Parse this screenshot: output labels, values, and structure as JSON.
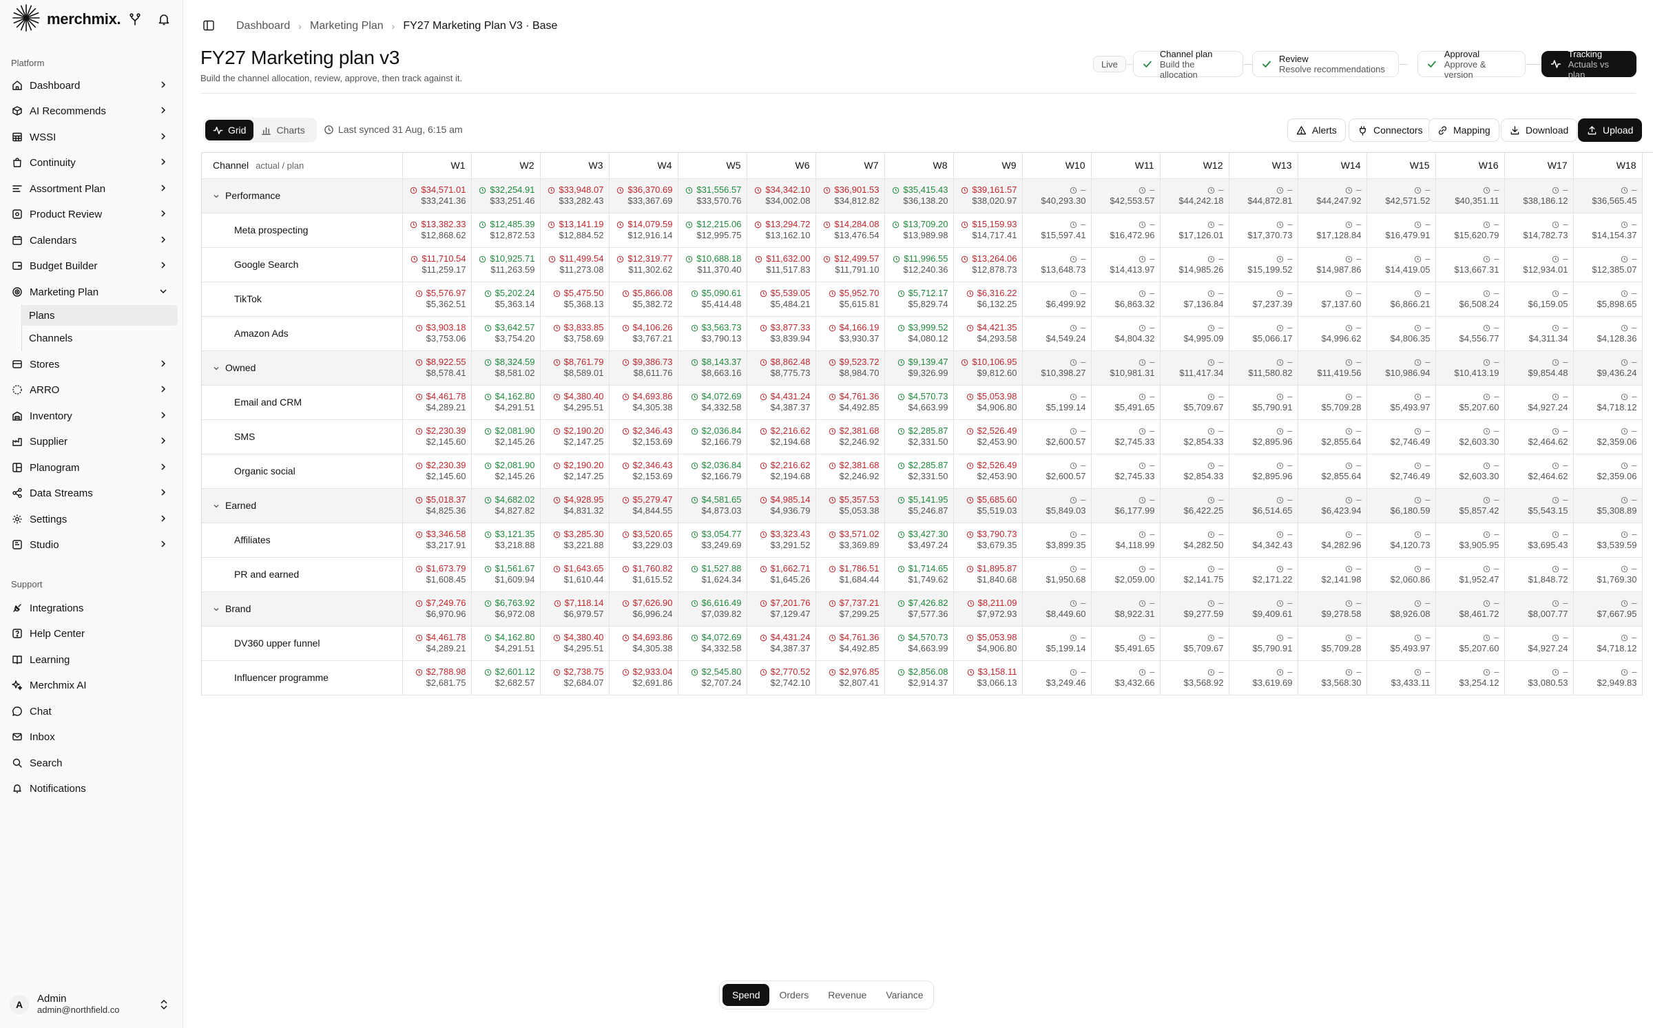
{
  "brand": {
    "name": "merchmix.",
    "icons": [
      "merge-icon",
      "bell-icon"
    ]
  },
  "sidebar": {
    "platform_label": "Platform",
    "support_label": "Support",
    "platform": [
      {
        "label": "Dashboard",
        "icon": "home-icon"
      },
      {
        "label": "AI Recommends",
        "icon": "box-icon"
      },
      {
        "label": "WSSI",
        "icon": "table-icon"
      },
      {
        "label": "Continuity",
        "icon": "bag-icon"
      },
      {
        "label": "Assortment Plan",
        "icon": "list-icon"
      },
      {
        "label": "Product Review",
        "icon": "review-icon"
      },
      {
        "label": "Calendars",
        "icon": "calendar-icon"
      },
      {
        "label": "Budget Builder",
        "icon": "budget-icon"
      },
      {
        "label": "Marketing Plan",
        "icon": "target-icon"
      },
      {
        "label": "Stores",
        "icon": "store-icon"
      },
      {
        "label": "ARRO",
        "icon": "arro-icon"
      },
      {
        "label": "Inventory",
        "icon": "warehouse-icon"
      },
      {
        "label": "Supplier",
        "icon": "supplier-icon"
      },
      {
        "label": "Planogram",
        "icon": "planogram-icon"
      },
      {
        "label": "Data Streams",
        "icon": "share-icon"
      },
      {
        "label": "Settings",
        "icon": "gear-icon"
      },
      {
        "label": "Studio",
        "icon": "studio-icon"
      }
    ],
    "marketing_sub": [
      "Plans",
      "Channels"
    ],
    "support": [
      {
        "label": "Integrations",
        "icon": "plug-icon"
      },
      {
        "label": "Help Center",
        "icon": "help-icon"
      },
      {
        "label": "Learning",
        "icon": "book-icon"
      },
      {
        "label": "Merchmix AI",
        "icon": "sparkle-icon"
      },
      {
        "label": "Chat",
        "icon": "chat-icon"
      },
      {
        "label": "Inbox",
        "icon": "mail-icon"
      },
      {
        "label": "Search",
        "icon": "search-icon"
      },
      {
        "label": "Notifications",
        "icon": "bell-icon"
      }
    ],
    "user": {
      "initial": "A",
      "name": "Admin",
      "email": "admin@northfield.co"
    }
  },
  "breadcrumb": [
    "Dashboard",
    "Marketing Plan",
    "FY27 Marketing Plan V3 · Base"
  ],
  "page": {
    "title": "FY27 Marketing plan v3",
    "subtitle": "Build the channel allocation, review, approve, then track against it."
  },
  "stages": {
    "live": "Live",
    "items": [
      {
        "title": "Channel plan",
        "desc": "Build the allocation"
      },
      {
        "title": "Review",
        "desc": "Resolve recommendations"
      },
      {
        "title": "Approval",
        "desc": "Approve & version"
      },
      {
        "title": "Tracking",
        "desc": "Actuals vs plan"
      }
    ]
  },
  "toolbar": {
    "grid": "Grid",
    "charts": "Charts",
    "synced": "Last synced 31 Aug, 6:15 am",
    "alerts": "Alerts",
    "connectors": "Connectors",
    "mapping": "Mapping",
    "download": "Download",
    "upload": "Upload"
  },
  "grid": {
    "channel_header": "Channel",
    "channel_sub": "actual / plan",
    "weeks": [
      "W1",
      "W2",
      "W3",
      "W4",
      "W5",
      "W6",
      "W7",
      "W8",
      "W9",
      "W10",
      "W11",
      "W12",
      "W13",
      "W14",
      "W15",
      "W16",
      "W17",
      "W18"
    ],
    "pending_mark": "–",
    "rows": [
      {
        "type": "group",
        "name": "Performance",
        "actual": [
          "$34,571.01",
          "$32,254.91",
          "$33,948.07",
          "$36,370.69",
          "$31,556.57",
          "$34,342.10",
          "$36,901.53",
          "$35,415.43",
          "$39,161.57"
        ],
        "status": [
          "o",
          "u",
          "o",
          "o",
          "u",
          "o",
          "o",
          "u",
          "o"
        ],
        "plan": [
          "$33,241.36",
          "$33,251.46",
          "$33,282.43",
          "$33,367.69",
          "$33,570.76",
          "$34,002.08",
          "$34,812.82",
          "$36,138.20",
          "$38,020.97",
          "$40,293.30",
          "$42,553.57",
          "$44,242.18",
          "$44,872.81",
          "$44,247.92",
          "$42,571.52",
          "$40,351.11",
          "$38,186.12",
          "$36,565.45"
        ]
      },
      {
        "type": "row",
        "name": "Meta prospecting",
        "actual": [
          "$13,382.33",
          "$12,485.39",
          "$13,141.19",
          "$14,079.59",
          "$12,215.06",
          "$13,294.72",
          "$14,284.08",
          "$13,709.20",
          "$15,159.93"
        ],
        "status": [
          "o",
          "u",
          "o",
          "o",
          "u",
          "o",
          "o",
          "u",
          "o"
        ],
        "plan": [
          "$12,868.62",
          "$12,872.53",
          "$12,884.52",
          "$12,916.14",
          "$12,995.75",
          "$13,162.10",
          "$13,476.54",
          "$13,989.98",
          "$14,717.41",
          "$15,597.41",
          "$16,472.96",
          "$17,126.01",
          "$17,370.73",
          "$17,128.84",
          "$16,479.91",
          "$15,620.79",
          "$14,782.73",
          "$14,154.37"
        ]
      },
      {
        "type": "row",
        "name": "Google Search",
        "actual": [
          "$11,710.54",
          "$10,925.71",
          "$11,499.54",
          "$12,319.77",
          "$10,688.18",
          "$11,632.00",
          "$12,499.57",
          "$11,996.55",
          "$13,264.06"
        ],
        "status": [
          "o",
          "u",
          "o",
          "o",
          "u",
          "o",
          "o",
          "u",
          "o"
        ],
        "plan": [
          "$11,259.17",
          "$11,263.59",
          "$11,273.08",
          "$11,302.62",
          "$11,370.40",
          "$11,517.83",
          "$11,791.10",
          "$12,240.36",
          "$12,878.73",
          "$13,648.73",
          "$14,413.97",
          "$14,985.26",
          "$15,199.52",
          "$14,987.86",
          "$14,419.05",
          "$13,667.31",
          "$12,934.01",
          "$12,385.07"
        ]
      },
      {
        "type": "row",
        "name": "TikTok",
        "actual": [
          "$5,576.97",
          "$5,202.24",
          "$5,475.50",
          "$5,866.08",
          "$5,090.61",
          "$5,539.05",
          "$5,952.70",
          "$5,712.17",
          "$6,316.22"
        ],
        "status": [
          "o",
          "u",
          "o",
          "o",
          "u",
          "o",
          "o",
          "u",
          "o"
        ],
        "plan": [
          "$5,362.51",
          "$5,363.14",
          "$5,368.13",
          "$5,382.72",
          "$5,414.48",
          "$5,484.21",
          "$5,615.81",
          "$5,829.74",
          "$6,132.25",
          "$6,499.92",
          "$6,863.32",
          "$7,136.84",
          "$7,237.39",
          "$7,137.60",
          "$6,866.21",
          "$6,508.24",
          "$6,159.05",
          "$5,898.65"
        ]
      },
      {
        "type": "row",
        "name": "Amazon Ads",
        "actual": [
          "$3,903.18",
          "$3,642.57",
          "$3,833.85",
          "$4,106.26",
          "$3,563.73",
          "$3,877.33",
          "$4,166.19",
          "$3,999.52",
          "$4,421.35"
        ],
        "status": [
          "o",
          "u",
          "o",
          "o",
          "u",
          "o",
          "o",
          "u",
          "o"
        ],
        "plan": [
          "$3,753.06",
          "$3,754.20",
          "$3,758.69",
          "$3,767.21",
          "$3,790.13",
          "$3,839.94",
          "$3,930.37",
          "$4,080.12",
          "$4,293.58",
          "$4,549.24",
          "$4,804.32",
          "$4,995.09",
          "$5,066.17",
          "$4,996.62",
          "$4,806.35",
          "$4,556.77",
          "$4,311.34",
          "$4,128.36"
        ]
      },
      {
        "type": "group",
        "name": "Owned",
        "actual": [
          "$8,922.55",
          "$8,324.59",
          "$8,761.79",
          "$9,386.73",
          "$8,143.37",
          "$8,862.48",
          "$9,523.72",
          "$9,139.47",
          "$10,106.95"
        ],
        "status": [
          "o",
          "u",
          "o",
          "o",
          "u",
          "o",
          "o",
          "u",
          "o"
        ],
        "plan": [
          "$8,578.41",
          "$8,581.02",
          "$8,589.01",
          "$8,611.76",
          "$8,663.16",
          "$8,775.73",
          "$8,984.70",
          "$9,326.99",
          "$9,812.60",
          "$10,398.27",
          "$10,981.31",
          "$11,417.34",
          "$11,580.82",
          "$11,419.56",
          "$10,986.94",
          "$10,413.19",
          "$9,854.48",
          "$9,436.24"
        ]
      },
      {
        "type": "row",
        "name": "Email and CRM",
        "actual": [
          "$4,461.78",
          "$4,162.80",
          "$4,380.40",
          "$4,693.86",
          "$4,072.69",
          "$4,431.24",
          "$4,761.36",
          "$4,570.73",
          "$5,053.98"
        ],
        "status": [
          "o",
          "u",
          "o",
          "o",
          "u",
          "o",
          "o",
          "u",
          "o"
        ],
        "plan": [
          "$4,289.21",
          "$4,291.51",
          "$4,295.51",
          "$4,305.38",
          "$4,332.58",
          "$4,387.37",
          "$4,492.85",
          "$4,663.99",
          "$4,906.80",
          "$5,199.14",
          "$5,491.65",
          "$5,709.67",
          "$5,790.91",
          "$5,709.28",
          "$5,493.97",
          "$5,207.60",
          "$4,927.24",
          "$4,718.12"
        ]
      },
      {
        "type": "row",
        "name": "SMS",
        "actual": [
          "$2,230.39",
          "$2,081.90",
          "$2,190.20",
          "$2,346.43",
          "$2,036.84",
          "$2,216.62",
          "$2,381.68",
          "$2,285.87",
          "$2,526.49"
        ],
        "status": [
          "o",
          "u",
          "o",
          "o",
          "u",
          "o",
          "o",
          "u",
          "o"
        ],
        "plan": [
          "$2,145.60",
          "$2,145.26",
          "$2,147.25",
          "$2,153.69",
          "$2,166.79",
          "$2,194.68",
          "$2,246.92",
          "$2,331.50",
          "$2,453.90",
          "$2,600.57",
          "$2,745.33",
          "$2,854.33",
          "$2,895.96",
          "$2,855.64",
          "$2,746.49",
          "$2,603.30",
          "$2,464.62",
          "$2,359.06"
        ]
      },
      {
        "type": "row",
        "name": "Organic social",
        "actual": [
          "$2,230.39",
          "$2,081.90",
          "$2,190.20",
          "$2,346.43",
          "$2,036.84",
          "$2,216.62",
          "$2,381.68",
          "$2,285.87",
          "$2,526.49"
        ],
        "status": [
          "o",
          "u",
          "o",
          "o",
          "u",
          "o",
          "o",
          "u",
          "o"
        ],
        "plan": [
          "$2,145.60",
          "$2,145.26",
          "$2,147.25",
          "$2,153.69",
          "$2,166.79",
          "$2,194.68",
          "$2,246.92",
          "$2,331.50",
          "$2,453.90",
          "$2,600.57",
          "$2,745.33",
          "$2,854.33",
          "$2,895.96",
          "$2,855.64",
          "$2,746.49",
          "$2,603.30",
          "$2,464.62",
          "$2,359.06"
        ]
      },
      {
        "type": "group",
        "name": "Earned",
        "actual": [
          "$5,018.37",
          "$4,682.02",
          "$4,928.95",
          "$5,279.47",
          "$4,581.65",
          "$4,985.14",
          "$5,357.53",
          "$5,141.95",
          "$5,685.60"
        ],
        "status": [
          "o",
          "u",
          "o",
          "o",
          "u",
          "o",
          "o",
          "u",
          "o"
        ],
        "plan": [
          "$4,825.36",
          "$4,827.82",
          "$4,831.32",
          "$4,844.55",
          "$4,873.03",
          "$4,936.79",
          "$5,053.38",
          "$5,246.87",
          "$5,519.03",
          "$5,849.03",
          "$6,177.99",
          "$6,422.25",
          "$6,514.65",
          "$6,423.94",
          "$6,180.59",
          "$5,857.42",
          "$5,543.15",
          "$5,308.89"
        ]
      },
      {
        "type": "row",
        "name": "Affiliates",
        "actual": [
          "$3,346.58",
          "$3,121.35",
          "$3,285.30",
          "$3,520.65",
          "$3,054.77",
          "$3,323.43",
          "$3,571.02",
          "$3,427.30",
          "$3,790.73"
        ],
        "status": [
          "o",
          "u",
          "o",
          "o",
          "u",
          "o",
          "o",
          "u",
          "o"
        ],
        "plan": [
          "$3,217.91",
          "$3,218.88",
          "$3,221.88",
          "$3,229.03",
          "$3,249.69",
          "$3,291.52",
          "$3,369.89",
          "$3,497.24",
          "$3,679.35",
          "$3,899.35",
          "$4,118.99",
          "$4,282.50",
          "$4,342.43",
          "$4,282.96",
          "$4,120.73",
          "$3,905.95",
          "$3,695.43",
          "$3,539.59"
        ]
      },
      {
        "type": "row",
        "name": "PR and earned",
        "actual": [
          "$1,673.79",
          "$1,561.67",
          "$1,643.65",
          "$1,760.82",
          "$1,527.88",
          "$1,662.71",
          "$1,786.51",
          "$1,714.65",
          "$1,895.87"
        ],
        "status": [
          "o",
          "u",
          "o",
          "o",
          "u",
          "o",
          "o",
          "u",
          "o"
        ],
        "plan": [
          "$1,608.45",
          "$1,609.94",
          "$1,610.44",
          "$1,615.52",
          "$1,624.34",
          "$1,645.26",
          "$1,684.44",
          "$1,749.62",
          "$1,840.68",
          "$1,950.68",
          "$2,059.00",
          "$2,141.75",
          "$2,171.22",
          "$2,141.98",
          "$2,060.86",
          "$1,952.47",
          "$1,848.72",
          "$1,769.30"
        ]
      },
      {
        "type": "group",
        "name": "Brand",
        "actual": [
          "$7,249.76",
          "$6,763.92",
          "$7,118.14",
          "$7,626.90",
          "$6,616.49",
          "$7,201.76",
          "$7,737.21",
          "$7,426.82",
          "$8,211.09"
        ],
        "status": [
          "o",
          "u",
          "o",
          "o",
          "u",
          "o",
          "o",
          "u",
          "o"
        ],
        "plan": [
          "$6,970.96",
          "$6,972.08",
          "$6,979.57",
          "$6,996.24",
          "$7,039.82",
          "$7,129.47",
          "$7,299.25",
          "$7,577.36",
          "$7,972.93",
          "$8,449.60",
          "$8,922.31",
          "$9,277.59",
          "$9,409.61",
          "$9,278.58",
          "$8,926.08",
          "$8,461.72",
          "$8,007.77",
          "$7,667.95"
        ]
      },
      {
        "type": "row",
        "name": "DV360 upper funnel",
        "actual": [
          "$4,461.78",
          "$4,162.80",
          "$4,380.40",
          "$4,693.86",
          "$4,072.69",
          "$4,431.24",
          "$4,761.36",
          "$4,570.73",
          "$5,053.98"
        ],
        "status": [
          "o",
          "u",
          "o",
          "o",
          "u",
          "o",
          "o",
          "u",
          "o"
        ],
        "plan": [
          "$4,289.21",
          "$4,291.51",
          "$4,295.51",
          "$4,305.38",
          "$4,332.58",
          "$4,387.37",
          "$4,492.85",
          "$4,663.99",
          "$4,906.80",
          "$5,199.14",
          "$5,491.65",
          "$5,709.67",
          "$5,790.91",
          "$5,709.28",
          "$5,493.97",
          "$5,207.60",
          "$4,927.24",
          "$4,718.12"
        ]
      },
      {
        "type": "row",
        "name": "Influencer programme",
        "actual": [
          "$2,788.98",
          "$2,601.12",
          "$2,738.75",
          "$2,933.04",
          "$2,545.80",
          "$2,770.52",
          "$2,976.85",
          "$2,856.08",
          "$3,158.11"
        ],
        "status": [
          "o",
          "u",
          "o",
          "o",
          "u",
          "o",
          "o",
          "u",
          "o"
        ],
        "plan": [
          "$2,681.75",
          "$2,682.57",
          "$2,684.07",
          "$2,691.86",
          "$2,707.24",
          "$2,742.10",
          "$2,807.41",
          "$2,914.37",
          "$3,066.13",
          "$3,249.46",
          "$3,432.66",
          "$3,568.92",
          "$3,619.69",
          "$3,568.30",
          "$3,433.11",
          "$3,254.12",
          "$3,080.53",
          "$2,949.83"
        ]
      }
    ]
  },
  "metric_toggle": [
    "Spend",
    "Orders",
    "Revenue",
    "Variance"
  ],
  "colors": {
    "over": "#c1272d",
    "under": "#1f8a3b",
    "accent": "#111111"
  }
}
